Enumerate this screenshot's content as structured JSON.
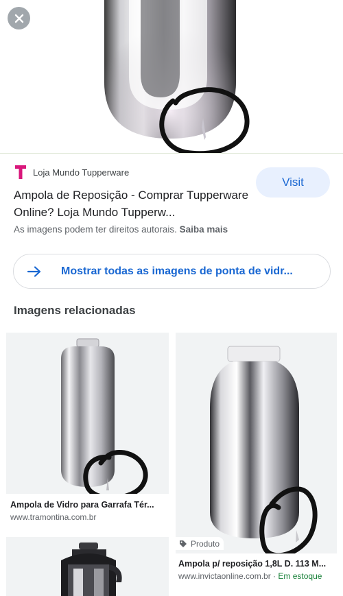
{
  "source": {
    "name": "Loja Mundo Tupperware",
    "logo_letter": "T",
    "logo_color": "#d9177b"
  },
  "visit_label": "Visit",
  "title": "Ampola de Reposição - Comprar Tupperware Online? Loja Mundo Tupperw...",
  "copyright": {
    "text": "As imagens podem ter direitos autorais.",
    "learn_more": "Saiba mais"
  },
  "show_all_label": "Mostrar todas as imagens de ponta de vidr...",
  "related": {
    "title": "Imagens relacionadas",
    "items": [
      {
        "caption": "Ampola de Vidro para Garrafa Tér...",
        "domain": "www.tramontina.com.br"
      },
      {
        "badge": "Produto",
        "caption": "Ampola p/ reposição 1,8L D. 113 M...",
        "domain": "www.invictaonline.com.br",
        "stock_separator": " · ",
        "stock": "Em estoque"
      }
    ]
  },
  "colors": {
    "accent_blue": "#1967d2",
    "visit_bg": "#e8f0fe",
    "stock_green": "#188038",
    "annotation_ink": "#111111"
  },
  "icons": [
    "close-icon",
    "arrow-right-icon",
    "tag-icon",
    "store-logo-icon"
  ]
}
